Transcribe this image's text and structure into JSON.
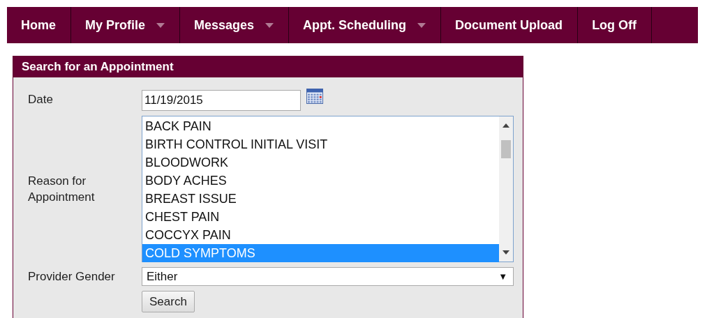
{
  "nav": [
    {
      "label": "Home",
      "dropdown": false
    },
    {
      "label": "My Profile",
      "dropdown": true
    },
    {
      "label": "Messages",
      "dropdown": true
    },
    {
      "label": "Appt. Scheduling",
      "dropdown": true
    },
    {
      "label": "Document Upload",
      "dropdown": false
    },
    {
      "label": "Log Off",
      "dropdown": false
    }
  ],
  "panel": {
    "title": "Search for an Appointment",
    "date": {
      "label": "Date",
      "value": "11/19/2015"
    },
    "reason": {
      "label": "Reason for Appointment",
      "options": [
        {
          "label": "BACK PAIN",
          "selected": false
        },
        {
          "label": "BIRTH CONTROL INITIAL VISIT",
          "selected": false
        },
        {
          "label": "BLOODWORK",
          "selected": false
        },
        {
          "label": "BODY ACHES",
          "selected": false
        },
        {
          "label": "BREAST ISSUE",
          "selected": false
        },
        {
          "label": "CHEST PAIN",
          "selected": false
        },
        {
          "label": "COCCYX PAIN",
          "selected": false
        },
        {
          "label": "COLD SYMPTOMS",
          "selected": true
        }
      ]
    },
    "gender": {
      "label": "Provider Gender",
      "value": "Either",
      "arrow": "▼"
    },
    "search_button": "Search"
  }
}
